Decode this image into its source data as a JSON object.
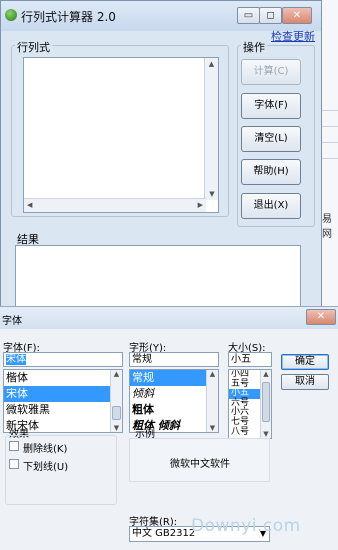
{
  "calculator": {
    "title": "行列式计算器 2.0",
    "window_buttons": {
      "minimize": "▭",
      "restore": "◻",
      "close": "✕"
    },
    "help_link": "检查更新",
    "matrix_group_label": "行列式",
    "ops_group_label": "操作",
    "buttons": {
      "calc": "计算(C)",
      "font": "字体(F)",
      "clear": "清空(L)",
      "help": "帮助(H)",
      "exit": "退出(X)"
    },
    "result_group_label": "结果",
    "side_text": "易网"
  },
  "font_dialog": {
    "title": "字体",
    "font_label": "字体(F):",
    "font_value": "宋体",
    "font_list": [
      "楷体",
      "宋体",
      "微软雅黑",
      "新宋体"
    ],
    "font_list_selected": 1,
    "style_label": "字形(Y):",
    "style_value": "常规",
    "style_list": [
      "常规",
      "倾斜",
      "粗体",
      "粗体 倾斜"
    ],
    "style_list_selected": 0,
    "size_label": "大小(S):",
    "size_value": "小五",
    "size_list": [
      "小四",
      "五号",
      "小五",
      "六号",
      "小六",
      "七号",
      "八号"
    ],
    "size_list_selected": 2,
    "ok_label": "确定",
    "cancel_label": "取消",
    "effects_label": "效果",
    "strike_label": "删除线(K)",
    "underline_label": "下划线(U)",
    "sample_label": "示例",
    "sample_text": "微软中文软件",
    "charset_label": "字符集(R):",
    "charset_value": "中文 GB2312"
  },
  "watermark": "Downyi.com",
  "colors": {
    "selection": "#3399ff",
    "watermark": "#b9d3ea"
  }
}
